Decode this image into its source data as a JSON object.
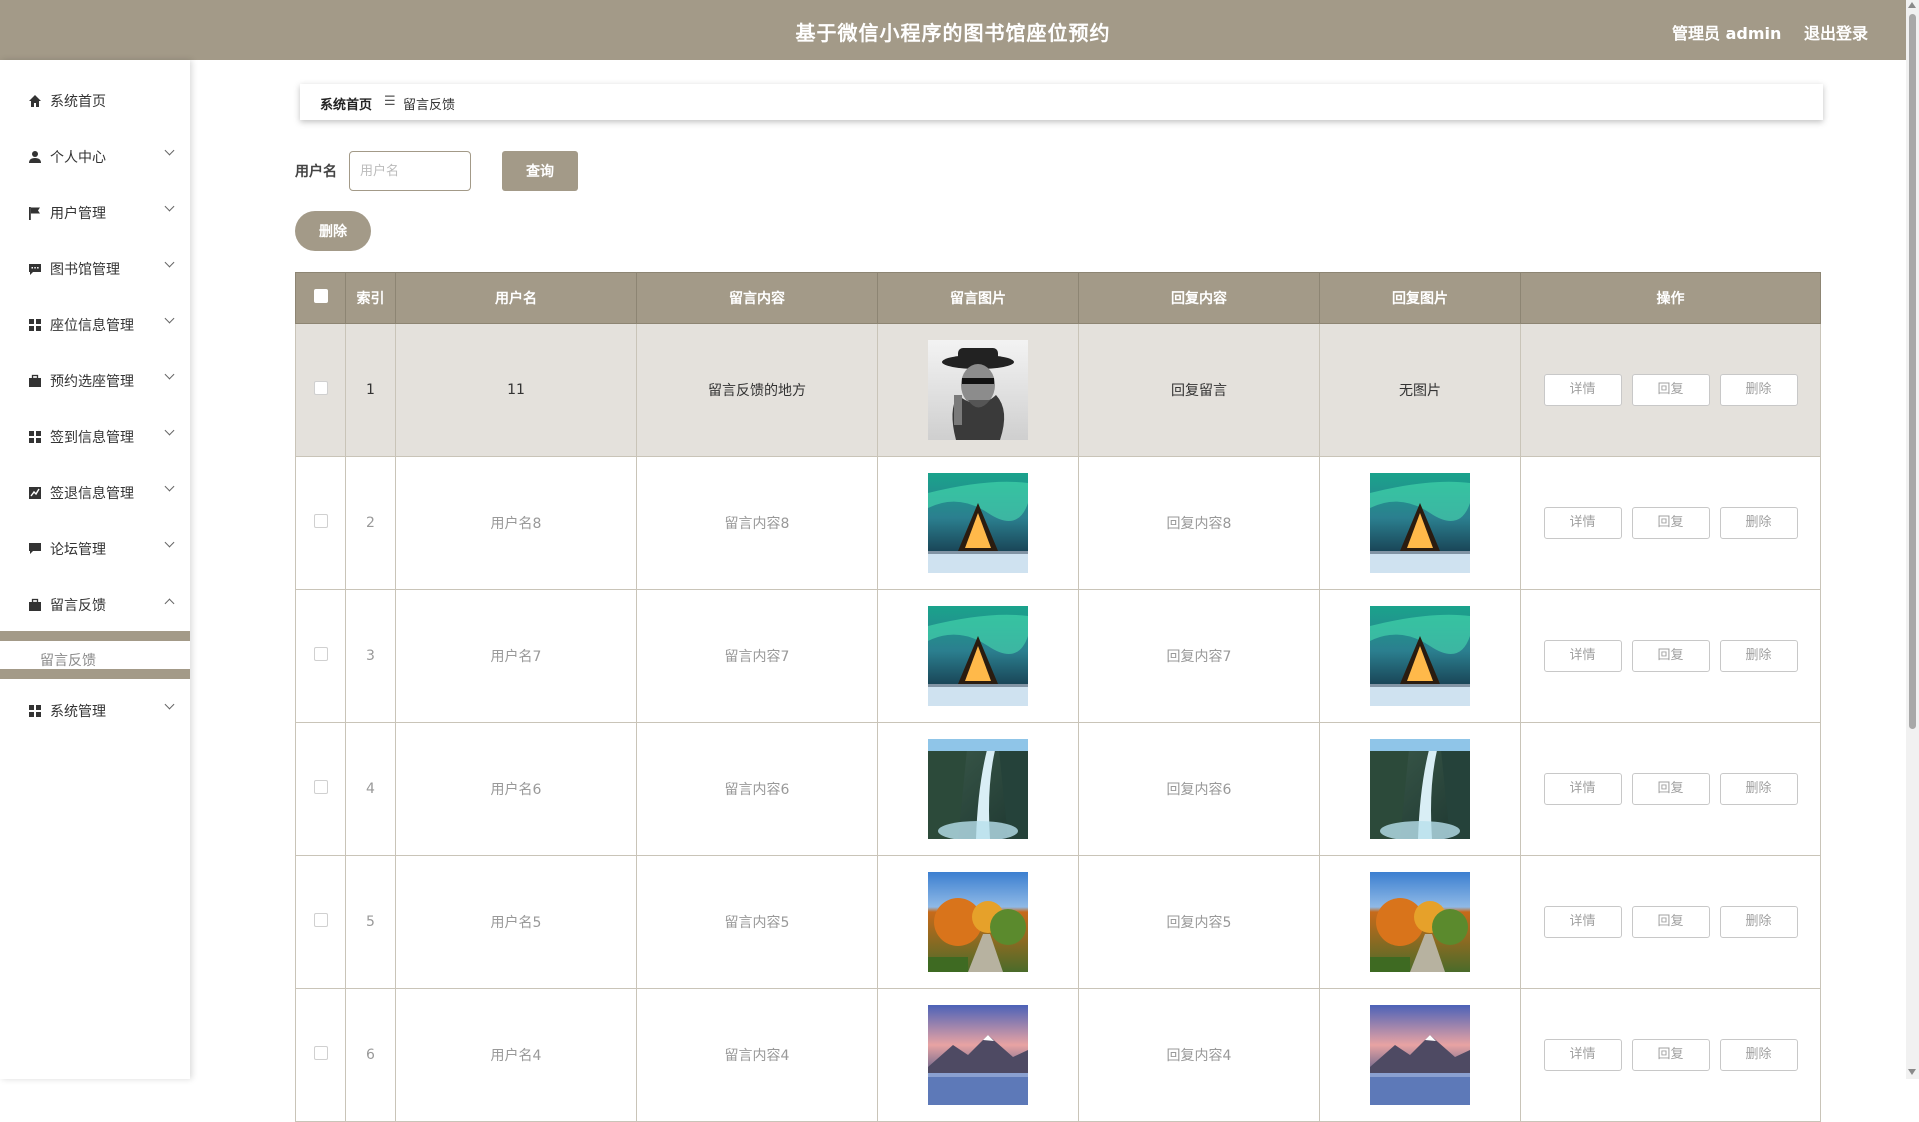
{
  "header": {
    "title": "基于微信小程序的图书馆座位预约",
    "user_label": "管理员 admin",
    "logout_label": "退出登录"
  },
  "sidebar": {
    "items": [
      {
        "label": "系统首页",
        "icon": "home-icon"
      },
      {
        "label": "个人中心",
        "icon": "user-icon"
      },
      {
        "label": "用户管理",
        "icon": "flag-icon"
      },
      {
        "label": "图书馆管理",
        "icon": "message-icon"
      },
      {
        "label": "座位信息管理",
        "icon": "grid-icon"
      },
      {
        "label": "预约选座管理",
        "icon": "briefcase-icon"
      },
      {
        "label": "签到信息管理",
        "icon": "grid-icon"
      },
      {
        "label": "签退信息管理",
        "icon": "chart-icon"
      },
      {
        "label": "论坛管理",
        "icon": "chat-icon"
      },
      {
        "label": "留言反馈",
        "icon": "briefcase-icon"
      },
      {
        "label": "系统管理",
        "icon": "grid-icon"
      }
    ],
    "submenu_item": "留言反馈"
  },
  "breadcrumb": {
    "home": "系统首页",
    "separator": "☰",
    "current": "留言反馈"
  },
  "search": {
    "label": "用户名",
    "placeholder": "用户名",
    "value": "",
    "query_button": "查询"
  },
  "actions": {
    "delete_button": "删除"
  },
  "table": {
    "columns": [
      "索引",
      "用户名",
      "留言内容",
      "留言图片",
      "回复内容",
      "回复图片",
      "操作"
    ],
    "operation_labels": {
      "detail": "详情",
      "reply": "回复",
      "delete": "删除"
    },
    "rows": [
      {
        "index": "1",
        "username": "11",
        "content": "留言反馈的地方",
        "image": "portrait",
        "reply": "回复留言",
        "reply_image": "",
        "reply_image_text": "无图片"
      },
      {
        "index": "2",
        "username": "用户名8",
        "content": "留言内容8",
        "image": "aurora",
        "reply": "回复内容8",
        "reply_image": "aurora"
      },
      {
        "index": "3",
        "username": "用户名7",
        "content": "留言内容7",
        "image": "aurora",
        "reply": "回复内容7",
        "reply_image": "aurora"
      },
      {
        "index": "4",
        "username": "用户名6",
        "content": "留言内容6",
        "image": "waterfall",
        "reply": "回复内容6",
        "reply_image": "waterfall"
      },
      {
        "index": "5",
        "username": "用户名5",
        "content": "留言内容5",
        "image": "autumn",
        "reply": "回复内容5",
        "reply_image": "autumn"
      },
      {
        "index": "6",
        "username": "用户名4",
        "content": "留言内容4",
        "image": "mountain",
        "reply": "回复内容4",
        "reply_image": "mountain"
      }
    ]
  },
  "colors": {
    "accent": "#a39a88",
    "highlight_row": "#e4e1dc"
  }
}
